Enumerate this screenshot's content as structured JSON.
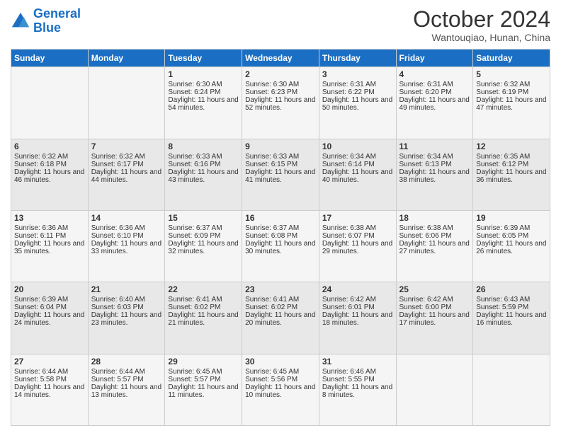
{
  "logo": {
    "line1": "General",
    "line2": "Blue"
  },
  "title": "October 2024",
  "location": "Wantouqiao, Hunan, China",
  "days_of_week": [
    "Sunday",
    "Monday",
    "Tuesday",
    "Wednesday",
    "Thursday",
    "Friday",
    "Saturday"
  ],
  "weeks": [
    [
      {
        "day": "",
        "sunrise": "",
        "sunset": "",
        "daylight": ""
      },
      {
        "day": "",
        "sunrise": "",
        "sunset": "",
        "daylight": ""
      },
      {
        "day": "1",
        "sunrise": "Sunrise: 6:30 AM",
        "sunset": "Sunset: 6:24 PM",
        "daylight": "Daylight: 11 hours and 54 minutes."
      },
      {
        "day": "2",
        "sunrise": "Sunrise: 6:30 AM",
        "sunset": "Sunset: 6:23 PM",
        "daylight": "Daylight: 11 hours and 52 minutes."
      },
      {
        "day": "3",
        "sunrise": "Sunrise: 6:31 AM",
        "sunset": "Sunset: 6:22 PM",
        "daylight": "Daylight: 11 hours and 50 minutes."
      },
      {
        "day": "4",
        "sunrise": "Sunrise: 6:31 AM",
        "sunset": "Sunset: 6:20 PM",
        "daylight": "Daylight: 11 hours and 49 minutes."
      },
      {
        "day": "5",
        "sunrise": "Sunrise: 6:32 AM",
        "sunset": "Sunset: 6:19 PM",
        "daylight": "Daylight: 11 hours and 47 minutes."
      }
    ],
    [
      {
        "day": "6",
        "sunrise": "Sunrise: 6:32 AM",
        "sunset": "Sunset: 6:18 PM",
        "daylight": "Daylight: 11 hours and 46 minutes."
      },
      {
        "day": "7",
        "sunrise": "Sunrise: 6:32 AM",
        "sunset": "Sunset: 6:17 PM",
        "daylight": "Daylight: 11 hours and 44 minutes."
      },
      {
        "day": "8",
        "sunrise": "Sunrise: 6:33 AM",
        "sunset": "Sunset: 6:16 PM",
        "daylight": "Daylight: 11 hours and 43 minutes."
      },
      {
        "day": "9",
        "sunrise": "Sunrise: 6:33 AM",
        "sunset": "Sunset: 6:15 PM",
        "daylight": "Daylight: 11 hours and 41 minutes."
      },
      {
        "day": "10",
        "sunrise": "Sunrise: 6:34 AM",
        "sunset": "Sunset: 6:14 PM",
        "daylight": "Daylight: 11 hours and 40 minutes."
      },
      {
        "day": "11",
        "sunrise": "Sunrise: 6:34 AM",
        "sunset": "Sunset: 6:13 PM",
        "daylight": "Daylight: 11 hours and 38 minutes."
      },
      {
        "day": "12",
        "sunrise": "Sunrise: 6:35 AM",
        "sunset": "Sunset: 6:12 PM",
        "daylight": "Daylight: 11 hours and 36 minutes."
      }
    ],
    [
      {
        "day": "13",
        "sunrise": "Sunrise: 6:36 AM",
        "sunset": "Sunset: 6:11 PM",
        "daylight": "Daylight: 11 hours and 35 minutes."
      },
      {
        "day": "14",
        "sunrise": "Sunrise: 6:36 AM",
        "sunset": "Sunset: 6:10 PM",
        "daylight": "Daylight: 11 hours and 33 minutes."
      },
      {
        "day": "15",
        "sunrise": "Sunrise: 6:37 AM",
        "sunset": "Sunset: 6:09 PM",
        "daylight": "Daylight: 11 hours and 32 minutes."
      },
      {
        "day": "16",
        "sunrise": "Sunrise: 6:37 AM",
        "sunset": "Sunset: 6:08 PM",
        "daylight": "Daylight: 11 hours and 30 minutes."
      },
      {
        "day": "17",
        "sunrise": "Sunrise: 6:38 AM",
        "sunset": "Sunset: 6:07 PM",
        "daylight": "Daylight: 11 hours and 29 minutes."
      },
      {
        "day": "18",
        "sunrise": "Sunrise: 6:38 AM",
        "sunset": "Sunset: 6:06 PM",
        "daylight": "Daylight: 11 hours and 27 minutes."
      },
      {
        "day": "19",
        "sunrise": "Sunrise: 6:39 AM",
        "sunset": "Sunset: 6:05 PM",
        "daylight": "Daylight: 11 hours and 26 minutes."
      }
    ],
    [
      {
        "day": "20",
        "sunrise": "Sunrise: 6:39 AM",
        "sunset": "Sunset: 6:04 PM",
        "daylight": "Daylight: 11 hours and 24 minutes."
      },
      {
        "day": "21",
        "sunrise": "Sunrise: 6:40 AM",
        "sunset": "Sunset: 6:03 PM",
        "daylight": "Daylight: 11 hours and 23 minutes."
      },
      {
        "day": "22",
        "sunrise": "Sunrise: 6:41 AM",
        "sunset": "Sunset: 6:02 PM",
        "daylight": "Daylight: 11 hours and 21 minutes."
      },
      {
        "day": "23",
        "sunrise": "Sunrise: 6:41 AM",
        "sunset": "Sunset: 6:02 PM",
        "daylight": "Daylight: 11 hours and 20 minutes."
      },
      {
        "day": "24",
        "sunrise": "Sunrise: 6:42 AM",
        "sunset": "Sunset: 6:01 PM",
        "daylight": "Daylight: 11 hours and 18 minutes."
      },
      {
        "day": "25",
        "sunrise": "Sunrise: 6:42 AM",
        "sunset": "Sunset: 6:00 PM",
        "daylight": "Daylight: 11 hours and 17 minutes."
      },
      {
        "day": "26",
        "sunrise": "Sunrise: 6:43 AM",
        "sunset": "Sunset: 5:59 PM",
        "daylight": "Daylight: 11 hours and 16 minutes."
      }
    ],
    [
      {
        "day": "27",
        "sunrise": "Sunrise: 6:44 AM",
        "sunset": "Sunset: 5:58 PM",
        "daylight": "Daylight: 11 hours and 14 minutes."
      },
      {
        "day": "28",
        "sunrise": "Sunrise: 6:44 AM",
        "sunset": "Sunset: 5:57 PM",
        "daylight": "Daylight: 11 hours and 13 minutes."
      },
      {
        "day": "29",
        "sunrise": "Sunrise: 6:45 AM",
        "sunset": "Sunset: 5:57 PM",
        "daylight": "Daylight: 11 hours and 11 minutes."
      },
      {
        "day": "30",
        "sunrise": "Sunrise: 6:45 AM",
        "sunset": "Sunset: 5:56 PM",
        "daylight": "Daylight: 11 hours and 10 minutes."
      },
      {
        "day": "31",
        "sunrise": "Sunrise: 6:46 AM",
        "sunset": "Sunset: 5:55 PM",
        "daylight": "Daylight: 11 hours and 8 minutes."
      },
      {
        "day": "",
        "sunrise": "",
        "sunset": "",
        "daylight": ""
      },
      {
        "day": "",
        "sunrise": "",
        "sunset": "",
        "daylight": ""
      }
    ]
  ]
}
